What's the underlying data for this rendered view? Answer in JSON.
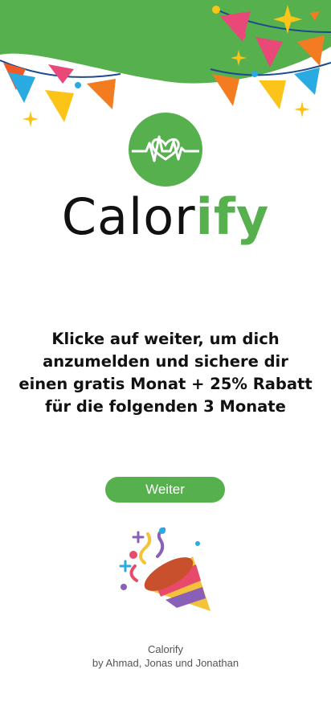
{
  "brand": {
    "name_part1": "Calor",
    "name_part2": "ify"
  },
  "promo": {
    "text": "Klicke auf weiter, um dich anzumelden und  sichere dir einen gratis Monat + 25% Rabatt für die folgenden 3 Monate"
  },
  "actions": {
    "continue_label": "Weiter"
  },
  "footer": {
    "app_name": "Calorify",
    "credits": "by Ahmad, Jonas und Jonathan"
  },
  "colors": {
    "accent": "#57b04e",
    "text": "#111111",
    "muted": "#555555"
  },
  "icons": {
    "logo": "heart-pulse-icon",
    "celebration": "party-popper-icon"
  }
}
